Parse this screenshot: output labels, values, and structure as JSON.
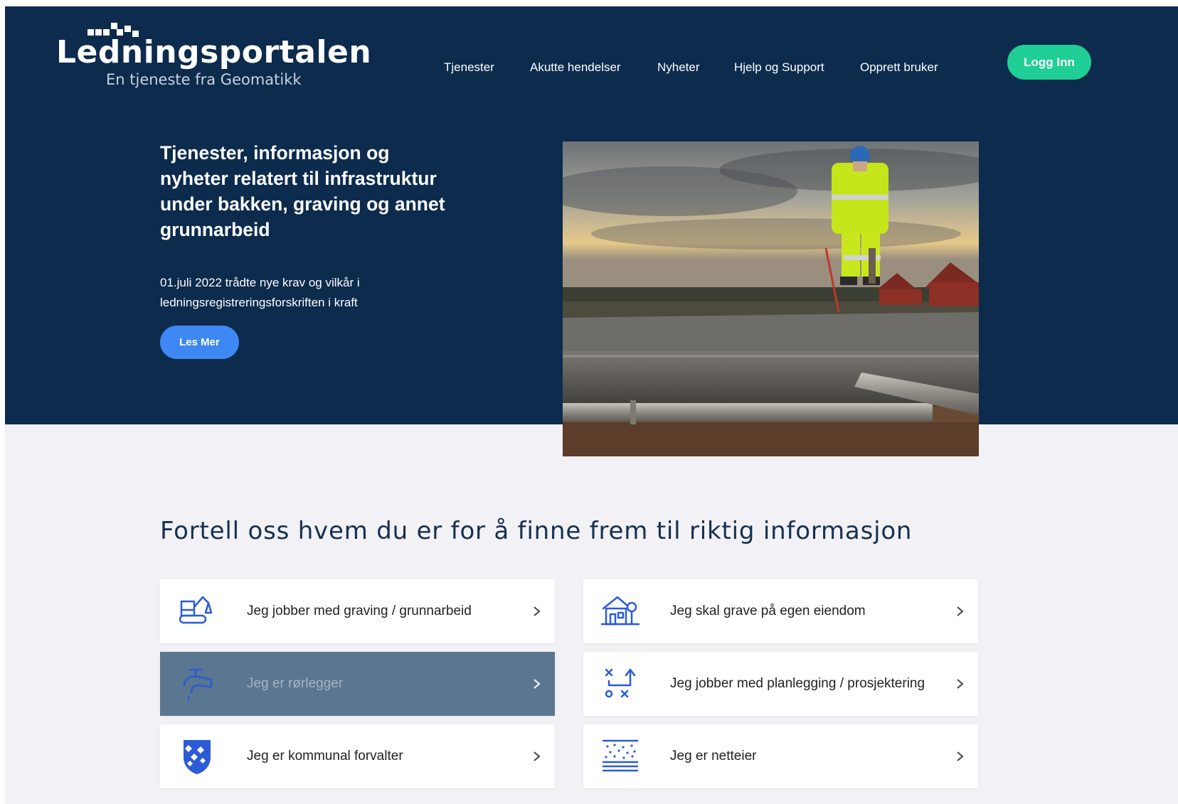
{
  "header": {
    "logo": {
      "name": "Ledningsportalen",
      "subtitle": "En tjeneste fra Geomatikk"
    },
    "nav": [
      {
        "label": "Tjenester"
      },
      {
        "label": "Akutte hendelser"
      },
      {
        "label": "Nyheter"
      },
      {
        "label": "Hjelp og Support"
      },
      {
        "label": "Opprett bruker"
      }
    ],
    "login_label": "Logg Inn"
  },
  "hero": {
    "heading": "Tjenester, informasjon og nyheter relatert til infrastruktur under bakken, graving og annet grunnarbeid",
    "text": "01.juli 2022 trådte nye krav og vilkår i ledningsregistreringsforskriften i kraft",
    "button_label": "Les Mer"
  },
  "section": {
    "title": "Fortell oss hvem du er for å finne frem til riktig informasjon",
    "cards": [
      {
        "label": "Jeg jobber med graving / grunnarbeid",
        "icon": "excavator-icon",
        "active": false
      },
      {
        "label": "Jeg skal grave på egen eiendom",
        "icon": "house-tree-icon",
        "active": false
      },
      {
        "label": "Jeg er rørlegger",
        "icon": "faucet-icon",
        "active": true
      },
      {
        "label": "Jeg jobber med planlegging / prosjektering",
        "icon": "strategy-plan-icon",
        "active": false
      },
      {
        "label": "Jeg er kommunal forvalter",
        "icon": "municipal-shield-icon",
        "active": false
      },
      {
        "label": "Jeg er netteier",
        "icon": "network-layers-icon",
        "active": false
      }
    ]
  },
  "colors": {
    "hero_bg": "#0c2b4d",
    "login_button": "#1fcf95",
    "read_more_button": "#3d88f2",
    "icon_blue": "#2b5bd7",
    "active_card": "#5a7690",
    "page_bg": "#f2f1f5"
  }
}
